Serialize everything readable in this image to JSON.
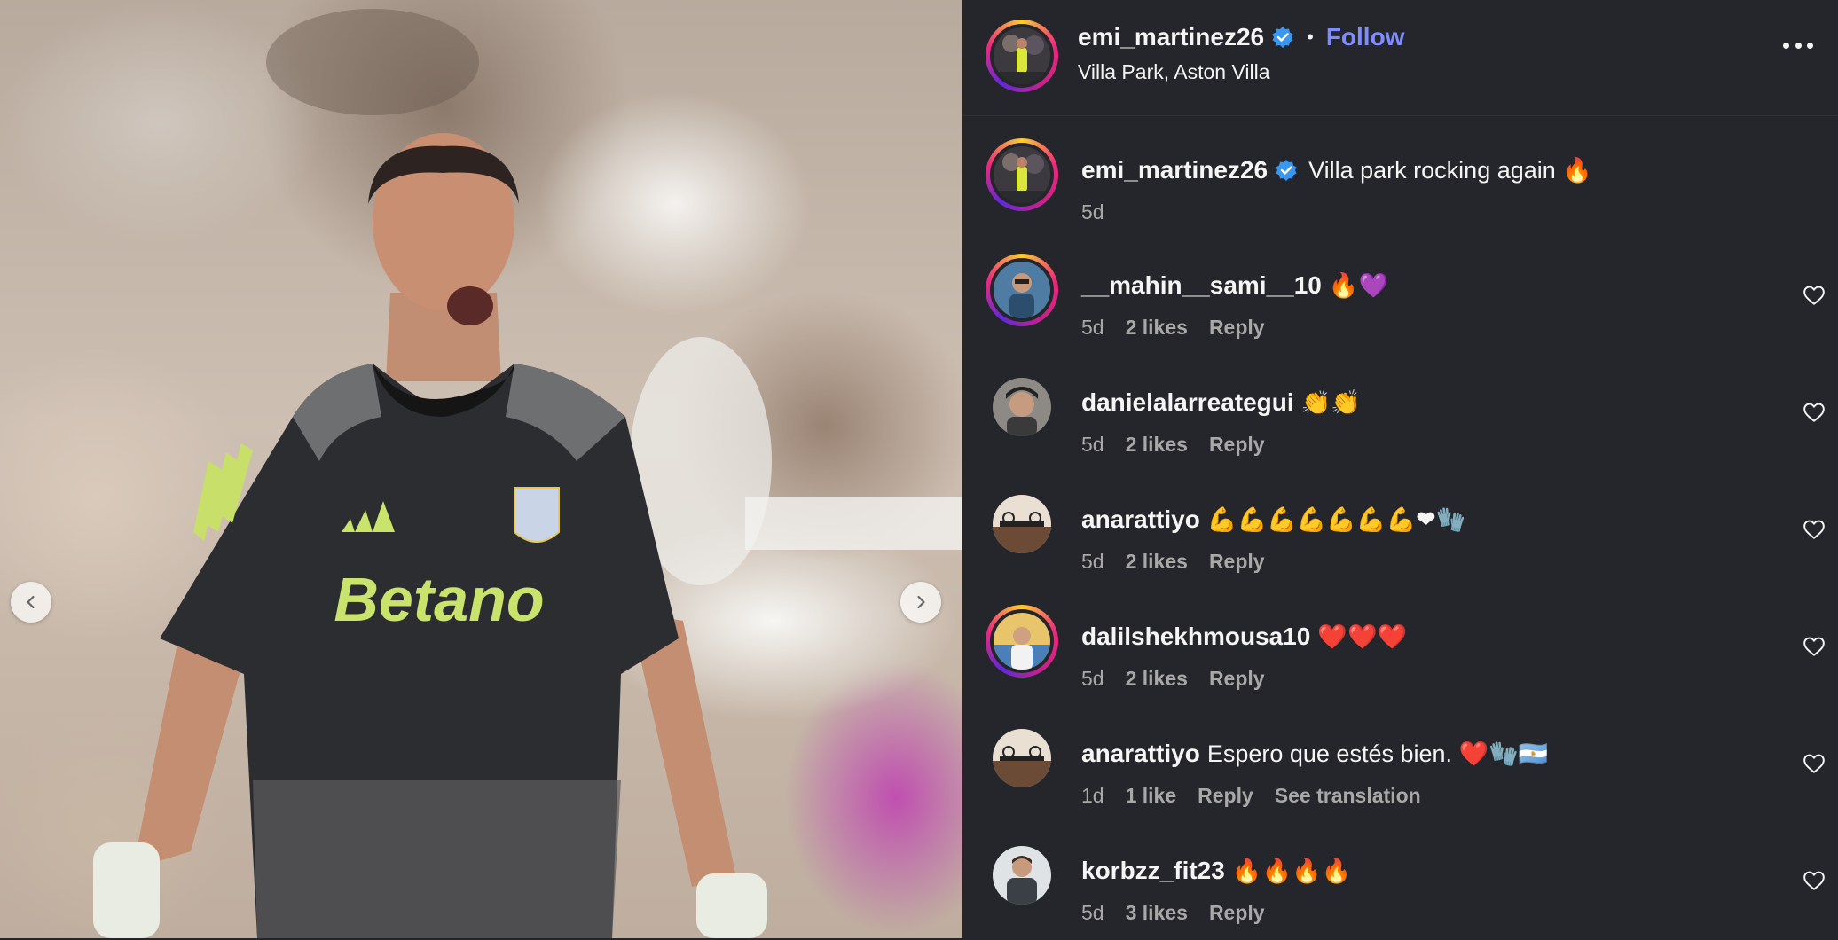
{
  "post": {
    "header": {
      "username": "emi_martinez26",
      "separator": "•",
      "follow_label": "Follow",
      "location": "Villa Park, Aston Villa"
    },
    "caption": {
      "username": "emi_martinez26",
      "text": "Villa park rocking again 🔥",
      "time": "5d"
    }
  },
  "media": {
    "shirt_sponsor": "Betano"
  },
  "comments": [
    {
      "username": "__mahin__sami__10",
      "text": "🔥💜",
      "time": "5d",
      "likes": "2 likes",
      "reply": "Reply"
    },
    {
      "username": "danielalarreategui",
      "text": "👏👏",
      "time": "5d",
      "likes": "2 likes",
      "reply": "Reply"
    },
    {
      "username": "anarattiyo",
      "text": "💪💪💪💪💪💪💪❤🧤",
      "time": "5d",
      "likes": "2 likes",
      "reply": "Reply"
    },
    {
      "username": "dalilshekhmousa10",
      "text": "❤️❤️❤️",
      "time": "5d",
      "likes": "2 likes",
      "reply": "Reply"
    },
    {
      "username": "anarattiyo",
      "text": "Espero que estés bien. ❤️🧤🇦🇷",
      "time": "1d",
      "likes": "1 like",
      "reply": "Reply",
      "translate": "See translation"
    },
    {
      "username": "korbzz_fit23",
      "text": "🔥🔥🔥🔥",
      "time": "5d",
      "likes": "3 likes",
      "reply": "Reply"
    }
  ],
  "colors": {
    "background": "#25262b",
    "follow": "#7f8cff",
    "verified": "#3897f0",
    "meta_text": "#a8a8a8"
  }
}
